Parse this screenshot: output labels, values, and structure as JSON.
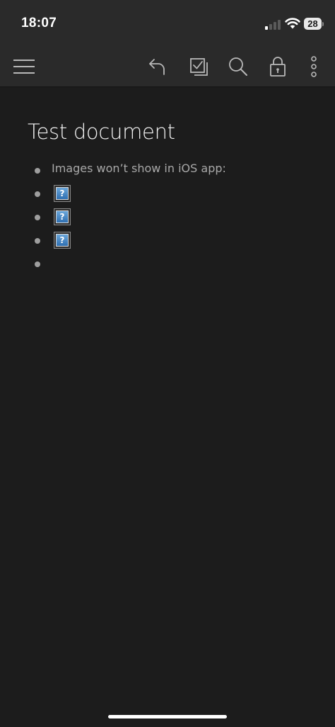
{
  "status_bar": {
    "time": "18:07",
    "battery_level": "28",
    "signal_bars_active": 1,
    "signal_bars_total": 4
  },
  "toolbar": {
    "buttons": [
      {
        "name": "menu",
        "icon": "hamburger-menu-icon"
      },
      {
        "name": "undo",
        "icon": "undo-arrow-icon"
      },
      {
        "name": "checklist",
        "icon": "checkbox-icon"
      },
      {
        "name": "search",
        "icon": "search-icon"
      },
      {
        "name": "lock",
        "icon": "lock-icon"
      },
      {
        "name": "more",
        "icon": "vertical-ellipsis-icon"
      }
    ]
  },
  "document": {
    "title": "Test document",
    "bullets": [
      {
        "type": "text",
        "text": "Images won’t show in iOS app:"
      },
      {
        "type": "image",
        "placeholder_glyph": "?"
      },
      {
        "type": "image",
        "placeholder_glyph": "?"
      },
      {
        "type": "image",
        "placeholder_glyph": "?"
      },
      {
        "type": "empty"
      }
    ]
  },
  "colors": {
    "background": "#1c1c1c",
    "bars": "#2a2a2a",
    "icon": "#b8b8b8",
    "title_text": "#f2f2f2",
    "body_text": "#a8a8a8",
    "placeholder_blue": "#3a7bbf"
  }
}
